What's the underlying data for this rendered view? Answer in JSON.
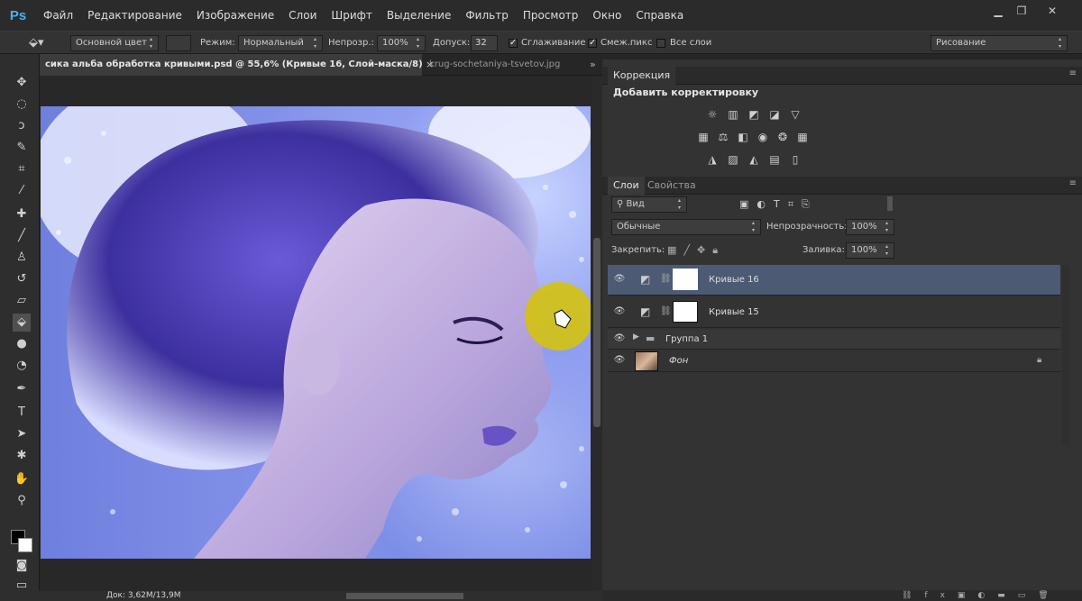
{
  "app": {
    "logo": "Ps"
  },
  "menu": [
    "Файл",
    "Редактирование",
    "Изображение",
    "Слои",
    "Шрифт",
    "Выделение",
    "Фильтр",
    "Просмотр",
    "Окно",
    "Справка"
  ],
  "window_controls": {
    "minimize": "▁",
    "restore": "❐",
    "close": "✕"
  },
  "options": {
    "fill_source": "Основной цвет",
    "mode_label": "Режим:",
    "mode_value": "Нормальный",
    "opacity_label": "Непрозр.:",
    "opacity_value": "100%",
    "tolerance_label": "Допуск:",
    "tolerance_value": "32",
    "antialias_label": "Сглаживание",
    "antialias_checked": "✓",
    "contiguous_label": "Смеж.пикс",
    "contiguous_checked": "✓",
    "all_layers_label": "Все слои",
    "workspace": "Рисование"
  },
  "documents": {
    "active_tab": "сика альба обработка кривыми.psd @ 55,6% (Кривые 16, Слой-маска/8) *",
    "close_glyph": "×",
    "other_tab": "krug-sochetaniya-tsvetov.jpg",
    "overflow": "»"
  },
  "status": {
    "doc_size": "Док: 3,62M/13,9M"
  },
  "correction": {
    "title": "Коррекция",
    "add_adjustment": "Добавить корректировку"
  },
  "layers_panel": {
    "tabs": [
      "Слои",
      "Свойства"
    ],
    "filter_label": "Вид",
    "blend_mode": "Обычные",
    "opacity_label": "Непрозрачность:",
    "opacity_value": "100%",
    "lock_label": "Закрепить:",
    "fill_label": "Заливка:",
    "fill_value": "100%",
    "layers": [
      {
        "name": "Кривые 16",
        "selected": true
      },
      {
        "name": "Кривые 15",
        "selected": false
      },
      {
        "name": "Группа 1",
        "selected": false
      },
      {
        "name": "Фон",
        "selected": false
      }
    ]
  },
  "colors": {
    "accent_select": "#4c5a73",
    "highlight": "#d4c20f"
  }
}
